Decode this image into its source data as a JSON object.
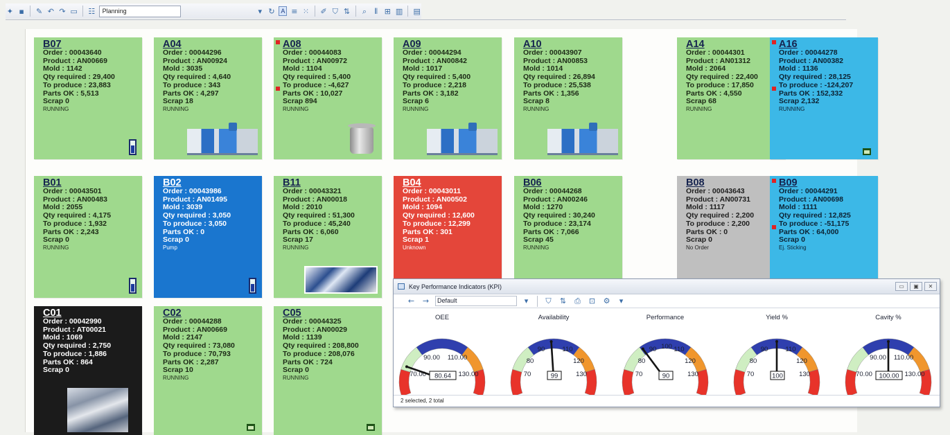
{
  "toolbar": {
    "view_select": "Planning",
    "toggle_label": "A"
  },
  "tiles": [
    {
      "code": "B07",
      "order": "Order : 00043640",
      "product": "Product : AN00669",
      "mold": "Mold : 1142",
      "qty": "Qty required : 29,400",
      "produce": "To produce : 23,883",
      "parts": "Parts OK : 5,513",
      "scrap": "Scrap 0",
      "status": "RUNNING",
      "color": "green"
    },
    {
      "code": "A04",
      "order": "Order : 00044296",
      "product": "Product : AN00924",
      "mold": "Mold : 3035",
      "qty": "Qty required : 4,640",
      "produce": "To produce : 343",
      "parts": "Parts OK : 4,297",
      "scrap": "Scrap 18",
      "status": "RUNNING",
      "color": "green"
    },
    {
      "code": "A08",
      "order": "Order : 00044083",
      "product": "Product : AN00972",
      "mold": "Mold : 1104",
      "qty": "Qty required : 5,400",
      "produce": "To produce : -4,627",
      "parts": "Parts OK : 10,027",
      "scrap": "Scrap 894",
      "status": "RUNNING",
      "color": "green"
    },
    {
      "code": "A09",
      "order": "Order : 00044294",
      "product": "Product : AN00842",
      "mold": "Mold : 1017",
      "qty": "Qty required : 5,400",
      "produce": "To produce : 2,218",
      "parts": "Parts OK : 3,182",
      "scrap": "Scrap 6",
      "status": "RUNNING",
      "color": "green"
    },
    {
      "code": "A10",
      "order": "Order : 00043907",
      "product": "Product : AN00853",
      "mold": "Mold : 1014",
      "qty": "Qty required : 26,894",
      "produce": "To produce : 25,538",
      "parts": "Parts OK : 1,356",
      "scrap": "Scrap 8",
      "status": "RUNNING",
      "color": "green"
    },
    {
      "code": "A14",
      "order": "Order : 00044301",
      "product": "Product : AN01312",
      "mold": "Mold : 2064",
      "qty": "Qty required : 22,400",
      "produce": "To produce : 17,850",
      "parts": "Parts OK : 4,550",
      "scrap": "Scrap 68",
      "status": "RUNNING",
      "color": "green"
    },
    {
      "code": "A16",
      "order": "Order : 00044278",
      "product": "Product : AN00382",
      "mold": "Mold : 1136",
      "qty": "Qty required : 28,125",
      "produce": "To produce : -124,207",
      "parts": "Parts OK : 152,332",
      "scrap": "Scrap 2,132",
      "status": "RUNNING",
      "color": "cyan"
    },
    {
      "code": "B01",
      "order": "Order : 00043501",
      "product": "Product : AN00483",
      "mold": "Mold : 2055",
      "qty": "Qty required : 4,175",
      "produce": "To produce : 1,932",
      "parts": "Parts OK : 2,243",
      "scrap": "Scrap 0",
      "status": "RUNNING",
      "color": "green"
    },
    {
      "code": "B02",
      "order": "Order : 00043986",
      "product": "Product : AN01495",
      "mold": "Mold : 3039",
      "qty": "Qty required : 3,050",
      "produce": "To produce : 3,050",
      "parts": "Parts OK : 0",
      "scrap": "Scrap 0",
      "status": "Pump",
      "color": "blue"
    },
    {
      "code": "B11",
      "order": "Order : 00043321",
      "product": "Product : AN00018",
      "mold": "Mold : 2010",
      "qty": "Qty required : 51,300",
      "produce": "To produce : 45,240",
      "parts": "Parts OK : 6,060",
      "scrap": "Scrap 17",
      "status": "RUNNING",
      "color": "green"
    },
    {
      "code": "B04",
      "order": "Order : 00043011",
      "product": "Product : AN00502",
      "mold": "Mold : 1094",
      "qty": "Qty required : 12,600",
      "produce": "To produce : 12,299",
      "parts": "Parts OK : 301",
      "scrap": "Scrap 1",
      "status": "Unknown",
      "color": "red"
    },
    {
      "code": "B06",
      "order": "Order : 00044268",
      "product": "Product : AN00246",
      "mold": "Mold : 1270",
      "qty": "Qty required : 30,240",
      "produce": "To produce : 23,174",
      "parts": "Parts OK : 7,066",
      "scrap": "Scrap 45",
      "status": "RUNNING",
      "color": "green"
    },
    {
      "code": "B08",
      "order": "Order : 00043643",
      "product": "Product : AN00731",
      "mold": "Mold : 1117",
      "qty": "Qty required : 2,200",
      "produce": "To produce : 2,200",
      "parts": "Parts OK : 0",
      "scrap": "Scrap 0",
      "status": "No Order",
      "color": "gray"
    },
    {
      "code": "B09",
      "order": "Order : 00044291",
      "product": "Product : AN00698",
      "mold": "Mold : 1111",
      "qty": "Qty required : 12,825",
      "produce": "To produce : -51,175",
      "parts": "Parts OK : 64,000",
      "scrap": "Scrap 0",
      "status": "Ej. Sticking",
      "color": "cyan"
    },
    {
      "code": "C01",
      "order": "Order : 00042990",
      "product": "Product : AT00021",
      "mold": "Mold : 1069",
      "qty": "Qty required : 2,750",
      "produce": "To produce : 1,886",
      "parts": "Parts OK : 864",
      "scrap": "Scrap 0",
      "status": "",
      "color": "black"
    },
    {
      "code": "C02",
      "order": "Order : 00044288",
      "product": "Product : AN00669",
      "mold": "Mold : 2147",
      "qty": "Qty required : 73,080",
      "produce": "To produce : 70,793",
      "parts": "Parts OK : 2,287",
      "scrap": "Scrap 10",
      "status": "RUNNING",
      "color": "green"
    },
    {
      "code": "C05",
      "order": "Order : 00044325",
      "product": "Product : AN00029",
      "mold": "Mold : 1139",
      "qty": "Qty required : 208,800",
      "produce": "To produce : 208,076",
      "parts": "Parts OK : 724",
      "scrap": "Scrap 0",
      "status": "RUNNING",
      "color": "green"
    }
  ],
  "kpi": {
    "window_title": "Key Performance Indicators (KPI)",
    "preset": "Default",
    "status": "2 selected, 2 total",
    "gauges": [
      {
        "label": "OEE",
        "value": 80.64,
        "value_text": "80.64",
        "min_label": "70.00",
        "max_label": "130.00",
        "l90": "90.00",
        "l110": "110.00",
        "style": "wide"
      },
      {
        "label": "Availability",
        "value": 99,
        "value_text": "99",
        "min_label": "70",
        "max_label": "130",
        "l80": "80",
        "l90": "90",
        "l110": "110",
        "l120": "120",
        "style": "int"
      },
      {
        "label": "Performance",
        "value": 90,
        "value_text": "90",
        "min_label": "70",
        "max_label": "130",
        "l80": "80",
        "l90": "90",
        "l100": "100",
        "l110": "110",
        "l120": "120",
        "style": "int"
      },
      {
        "label": "Yield %",
        "value": 100,
        "value_text": "100",
        "min_label": "70",
        "max_label": "130",
        "l80": "80",
        "l90": "90",
        "l110": "110",
        "l120": "120",
        "style": "int"
      },
      {
        "label": "Cavity %",
        "value": 100,
        "value_text": "100.00",
        "min_label": "70.00",
        "max_label": "130.00",
        "l90": "90.00",
        "l110": "110.00",
        "style": "wide"
      }
    ],
    "colors": {
      "red": "#e8332a",
      "orange": "#f0962d",
      "blue": "#2f3fae",
      "light_green": "#cfeec2",
      "white": "#ffffff"
    }
  }
}
